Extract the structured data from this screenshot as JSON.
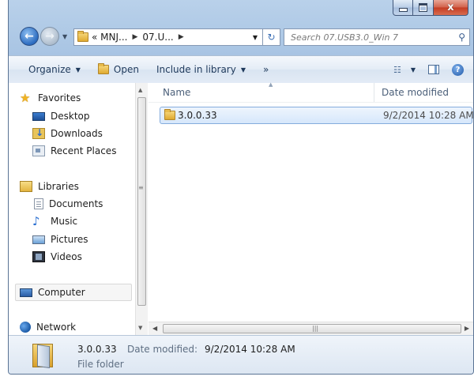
{
  "window": {
    "caption_buttons": {
      "minimize": "–",
      "maximize": "□",
      "close": "x"
    }
  },
  "address": {
    "breadcrumbs": [
      "« MNJ...",
      "07.U..."
    ],
    "search_placeholder": "Search 07.USB3.0_Win 7"
  },
  "toolbar": {
    "organize": "Organize",
    "open": "Open",
    "include_in_library": "Include in library",
    "more": "»"
  },
  "nav": {
    "favorites": {
      "label": "Favorites",
      "items": [
        "Desktop",
        "Downloads",
        "Recent Places"
      ]
    },
    "libraries": {
      "label": "Libraries",
      "items": [
        "Documents",
        "Music",
        "Pictures",
        "Videos"
      ]
    },
    "computer": "Computer",
    "network": "Network"
  },
  "files": {
    "columns": {
      "name": "Name",
      "date_modified": "Date modified"
    },
    "rows": [
      {
        "name": "3.0.0.33",
        "date": "9/2/2014 10:28 AM"
      }
    ]
  },
  "details": {
    "name": "3.0.0.33",
    "date_label": "Date modified:",
    "date_value": "9/2/2014 10:28 AM",
    "type": "File folder"
  },
  "colors": {
    "frame": "#b9d1ea",
    "selection": "#d6e7fb",
    "selection_border": "#84acdd",
    "toolbar_text": "#1e395b"
  }
}
